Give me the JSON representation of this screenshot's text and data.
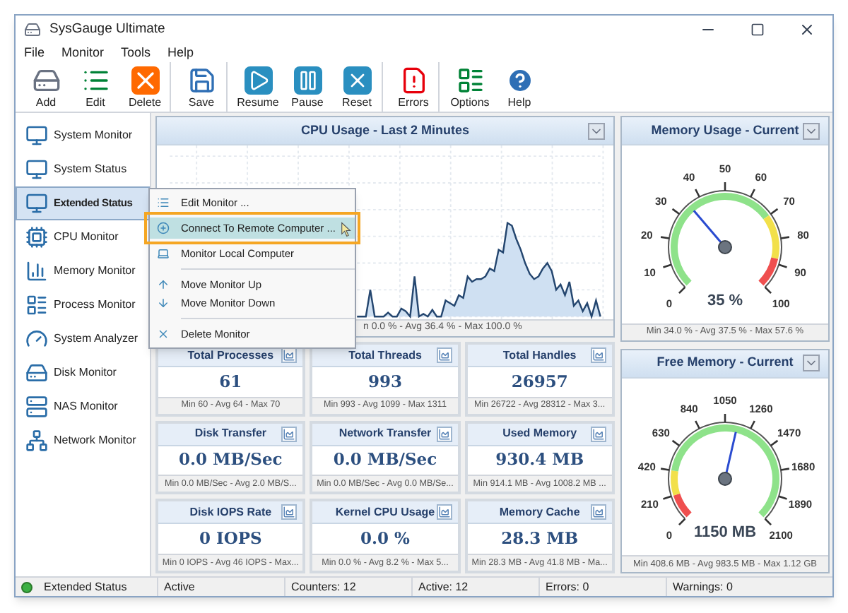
{
  "window": {
    "title": "SysGauge Ultimate"
  },
  "menu": [
    "File",
    "Monitor",
    "Tools",
    "Help"
  ],
  "toolbar": [
    [
      {
        "label": "Add"
      },
      {
        "label": "Edit"
      },
      {
        "label": "Delete"
      }
    ],
    [
      {
        "label": "Save"
      }
    ],
    [
      {
        "label": "Resume"
      },
      {
        "label": "Pause"
      },
      {
        "label": "Reset"
      }
    ],
    [
      {
        "label": "Errors"
      }
    ],
    [
      {
        "label": "Options"
      },
      {
        "label": "Help"
      }
    ]
  ],
  "sidebar": {
    "items": [
      {
        "label": "System Monitor",
        "selected": false
      },
      {
        "label": "System Status",
        "selected": false
      },
      {
        "label": "Extended Status",
        "selected": true
      },
      {
        "label": "CPU Monitor",
        "selected": false
      },
      {
        "label": "Memory Monitor",
        "selected": false
      },
      {
        "label": "Process Monitor",
        "selected": false
      },
      {
        "label": "System Analyzer",
        "selected": false
      },
      {
        "label": "Disk Monitor",
        "selected": false
      },
      {
        "label": "NAS Monitor",
        "selected": false
      },
      {
        "label": "Network Monitor",
        "selected": false
      }
    ]
  },
  "context_menu": {
    "items": [
      {
        "kind": "item",
        "label": "Edit Monitor ...",
        "selected": false
      },
      {
        "kind": "item",
        "label": "Connect To Remote Computer ...",
        "selected": true
      },
      {
        "kind": "item",
        "label": "Monitor Local Computer",
        "selected": false
      },
      {
        "kind": "separator"
      },
      {
        "kind": "item",
        "label": "Move Monitor Up",
        "selected": false
      },
      {
        "kind": "item",
        "label": "Move Monitor Down",
        "selected": false
      },
      {
        "kind": "separator"
      },
      {
        "kind": "item",
        "label": "Delete Monitor",
        "selected": false
      }
    ]
  },
  "cpu_chart": {
    "title": "CPU Usage - Last 2 Minutes",
    "summary": "n 0.0 % - Avg 36.4 % - Max 100.0 %"
  },
  "cards": [
    {
      "title": "Total Processes",
      "value": "61",
      "summary": "Min 60 - Avg 64 - Max 70"
    },
    {
      "title": "Total Threads",
      "value": "993",
      "summary": "Min 993 - Avg 1099 - Max 1311"
    },
    {
      "title": "Total Handles",
      "value": "26957",
      "summary": "Min 26722 - Avg 28312 - Max 3..."
    },
    {
      "title": "Disk Transfer",
      "value": "0.0 MB/Sec",
      "summary": "Min 0.0 MB/Sec - Avg 2.0 MB/S..."
    },
    {
      "title": "Network Transfer",
      "value": "0.0 MB/Sec",
      "summary": "Min 0.0 MB/Sec - Avg 0.0 MB/Se..."
    },
    {
      "title": "Used Memory",
      "value": "930.4 MB",
      "summary": "Min 914.1 MB - Avg 1008.2 MB ..."
    },
    {
      "title": "Disk IOPS Rate",
      "value": "0 IOPS",
      "summary": "Min 0 IOPS - Avg 46 IOPS - Max..."
    },
    {
      "title": "Kernel CPU Usage",
      "value": "0.0 %",
      "summary": "Min 0.0 % - Avg 8.2 % - Max 5..."
    },
    {
      "title": "Memory Cache",
      "value": "28.3 MB",
      "summary": "Min 28.3 MB - Avg 41.8 MB - Ma..."
    }
  ],
  "gauges": [
    {
      "kind": "usage",
      "title": "Memory Usage - Current",
      "ticks": [
        "0",
        "10",
        "20",
        "30",
        "40",
        "50",
        "60",
        "70",
        "80",
        "90",
        "100"
      ],
      "value": "35 %",
      "summary": "Min 34.0 % - Avg 37.5 % - Max 57.6 %"
    },
    {
      "kind": "free",
      "title": "Free Memory - Current",
      "ticks": [
        "0",
        "210",
        "420",
        "630",
        "840",
        "1050",
        "1260",
        "1470",
        "1680",
        "1890",
        "2100"
      ],
      "value": "1150 MB",
      "summary": "Min 408.6 MB - Avg 983.5 MB - Max 1.12 GB"
    }
  ],
  "status_bar": {
    "color": "#3cb043",
    "items": [
      "Extended Status",
      "Active",
      "Counters: 12",
      "Active: 12",
      "Errors: 0",
      "Warnings: 0"
    ]
  }
}
